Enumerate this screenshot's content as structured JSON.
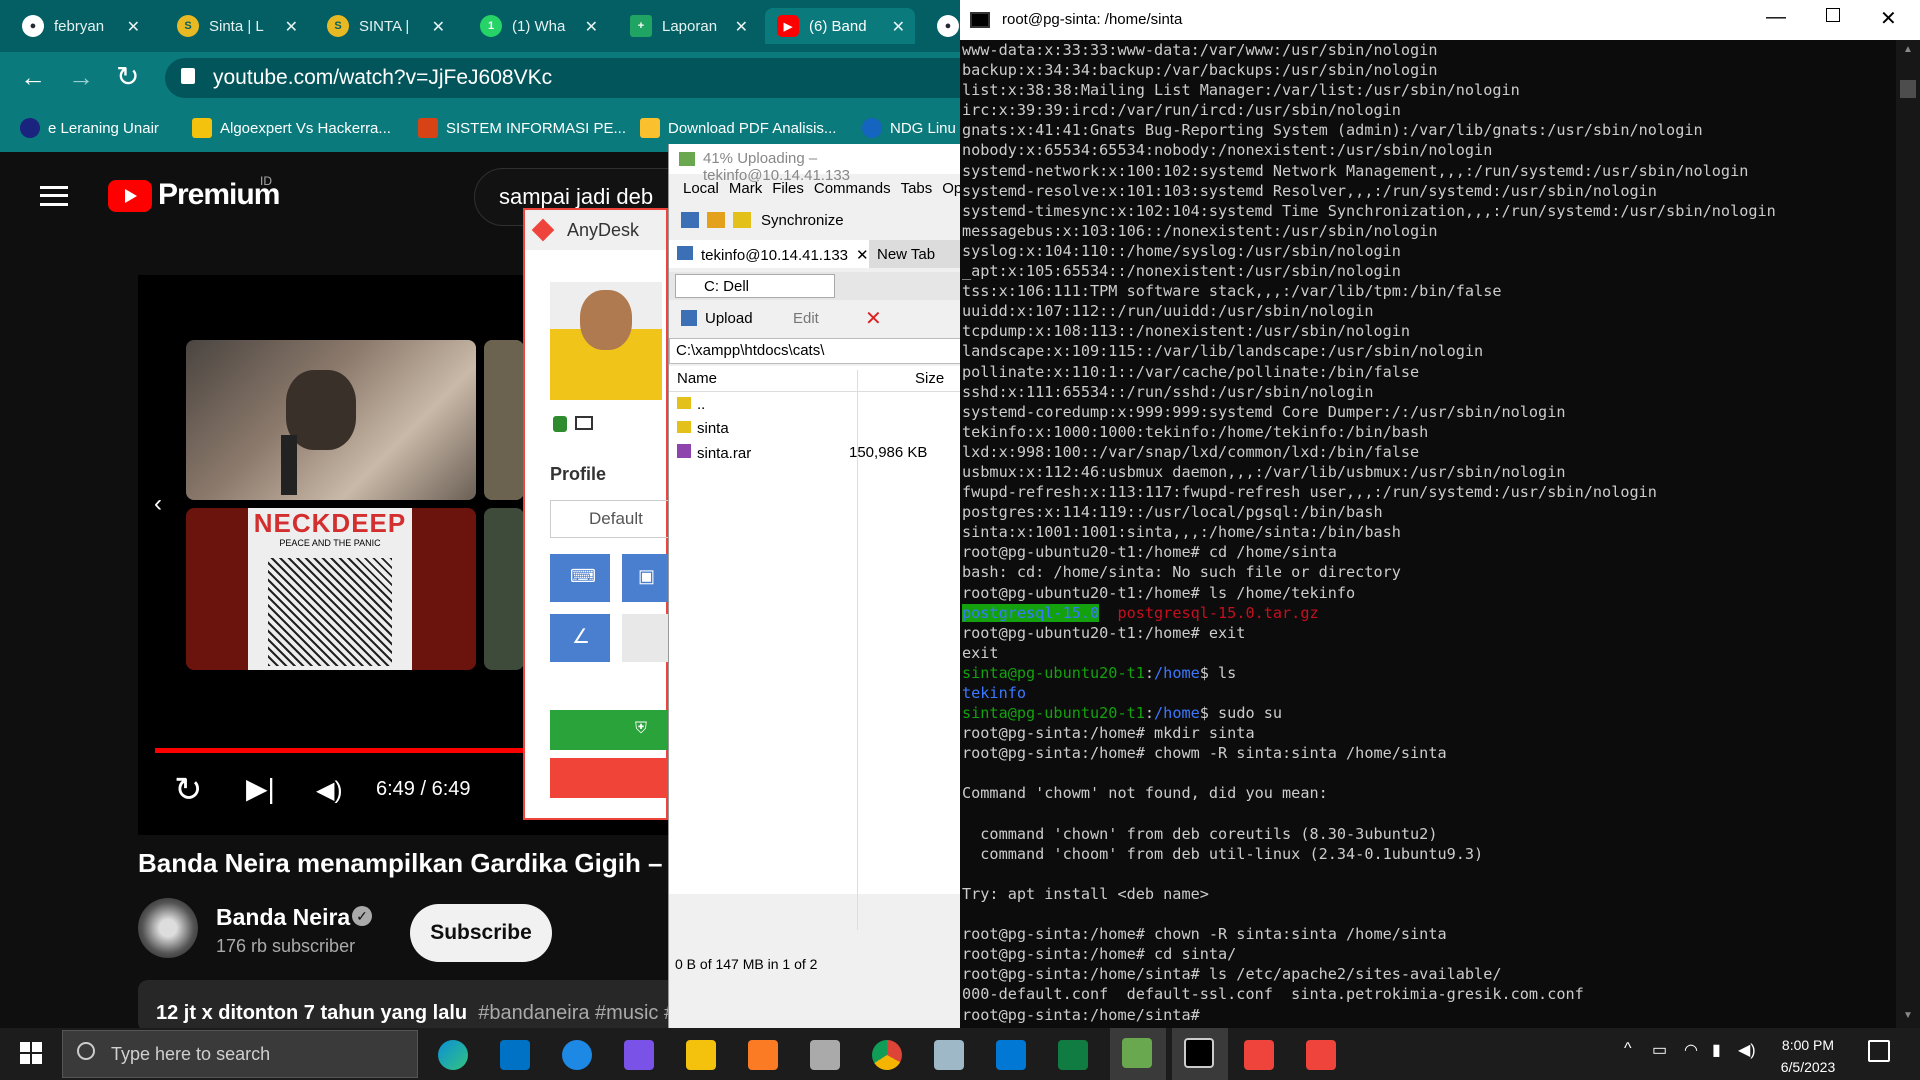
{
  "browser": {
    "tabs": [
      {
        "label": "febryan",
        "color": "#24292f"
      },
      {
        "label": "Sinta | L",
        "color": "#e8b923"
      },
      {
        "label": "SINTA |",
        "color": "#e8b923"
      },
      {
        "label": "(1) Wha",
        "color": "#25d366"
      },
      {
        "label": "Laporan",
        "color": "#1fa463"
      },
      {
        "label": "(6) Band",
        "color": "#ff0000"
      }
    ],
    "url": "youtube.com/watch?v=JjFeJ608VKc",
    "bookmarks": [
      {
        "label": "e Leraning Unair",
        "color": "#1a237e"
      },
      {
        "label": "Algoexpert Vs Hackerra...",
        "color": "#f4c20d"
      },
      {
        "label": "SISTEM INFORMASI PE...",
        "color": "#d84315"
      },
      {
        "label": "Download PDF Analisis...",
        "color": "#fbc02d"
      },
      {
        "label": "NDG Linu",
        "color": "#1565c0"
      }
    ]
  },
  "youtube": {
    "logo": "Premium",
    "region": "ID",
    "search_value": "sampai jadi deb",
    "time": "6:49 / 6:49",
    "progress": 1.0,
    "title": "Banda Neira menampilkan Gardika Gigih –",
    "channel": "Banda Neira",
    "subscribers": "176 rb subscriber",
    "subscribe_label": "Subscribe",
    "stats": "12 jt x ditonton  7 tahun yang lalu",
    "hashtags": "#bandaneira #music #indie",
    "album_text": "NECKDEEP",
    "album_sub": "PEACE AND THE PANIC"
  },
  "anydesk": {
    "title": "AnyDesk",
    "profile_label": "Profile",
    "profile_value": "Default"
  },
  "winscp": {
    "title": "41% Uploading – tekinfo@10.14.41.133",
    "menu": [
      "Local",
      "Mark",
      "Files",
      "Commands",
      "Tabs",
      "Op"
    ],
    "sync_label": "Synchronize",
    "session_tab": "tekinfo@10.14.41.133",
    "new_tab": "New Tab",
    "drive": "C: Dell",
    "upload": "Upload",
    "edit": "Edit",
    "path": "C:\\xampp\\htdocs\\cats\\",
    "col_name": "Name",
    "col_size": "Size",
    "files": [
      {
        "name": "..",
        "size": ""
      },
      {
        "name": "sinta",
        "size": ""
      },
      {
        "name": "sinta.rar",
        "size": "150,986 KB"
      }
    ],
    "status": "0 B of 147 MB in 1 of 2"
  },
  "terminal": {
    "title": "root@pg-sinta: /home/sinta",
    "lines": [
      "www-data:x:33:33:www-data:/var/www:/usr/sbin/nologin",
      "backup:x:34:34:backup:/var/backups:/usr/sbin/nologin",
      "list:x:38:38:Mailing List Manager:/var/list:/usr/sbin/nologin",
      "irc:x:39:39:ircd:/var/run/ircd:/usr/sbin/nologin",
      "gnats:x:41:41:Gnats Bug-Reporting System (admin):/var/lib/gnats:/usr/sbin/nologin",
      "nobody:x:65534:65534:nobody:/nonexistent:/usr/sbin/nologin",
      "systemd-network:x:100:102:systemd Network Management,,,:/run/systemd:/usr/sbin/nologin",
      "systemd-resolve:x:101:103:systemd Resolver,,,:/run/systemd:/usr/sbin/nologin",
      "systemd-timesync:x:102:104:systemd Time Synchronization,,,:/run/systemd:/usr/sbin/nologin",
      "messagebus:x:103:106::/nonexistent:/usr/sbin/nologin",
      "syslog:x:104:110::/home/syslog:/usr/sbin/nologin",
      "_apt:x:105:65534::/nonexistent:/usr/sbin/nologin",
      "tss:x:106:111:TPM software stack,,,:/var/lib/tpm:/bin/false",
      "uuidd:x:107:112::/run/uuidd:/usr/sbin/nologin",
      "tcpdump:x:108:113::/nonexistent:/usr/sbin/nologin",
      "landscape:x:109:115::/var/lib/landscape:/usr/sbin/nologin",
      "pollinate:x:110:1::/var/cache/pollinate:/bin/false",
      "sshd:x:111:65534::/run/sshd:/usr/sbin/nologin",
      "systemd-coredump:x:999:999:systemd Core Dumper:/:/usr/sbin/nologin",
      "tekinfo:x:1000:1000:tekinfo:/home/tekinfo:/bin/bash",
      "lxd:x:998:100::/var/snap/lxd/common/lxd:/bin/false",
      "usbmux:x:112:46:usbmux daemon,,,:/var/lib/usbmux:/usr/sbin/nologin",
      "fwupd-refresh:x:113:117:fwupd-refresh user,,,:/run/systemd:/usr/sbin/nologin",
      "postgres:x:114:119::/usr/local/pgsql:/bin/bash",
      "sinta:x:1001:1001:sinta,,,:/home/sinta:/bin/bash",
      "root@pg-ubuntu20-t1:/home# cd /home/sinta",
      "bash: cd: /home/sinta: No such file or directory",
      "root@pg-ubuntu20-t1:/home# ls /home/tekinfo"
    ],
    "ls_dir": "postgresql-15.0",
    "ls_file": "postgresql-15.0.tar.gz",
    "lines2": [
      "root@pg-ubuntu20-t1:/home# exit",
      "exit"
    ],
    "prompt_user": "sinta@pg-ubuntu20-t1",
    "prompt_path": "/home",
    "cmd_ls": "$ ls",
    "ls_out": "tekinfo",
    "cmd_su": "$ sudo su",
    "lines3": [
      "root@pg-sinta:/home# mkdir sinta",
      "root@pg-sinta:/home# chowm -R sinta:sinta /home/sinta",
      "",
      "Command 'chowm' not found, did you mean:",
      "",
      "  command 'chown' from deb coreutils (8.30-3ubuntu2)",
      "  command 'choom' from deb util-linux (2.34-0.1ubuntu9.3)",
      "",
      "Try: apt install <deb name>",
      "",
      "root@pg-sinta:/home# chown -R sinta:sinta /home/sinta",
      "root@pg-sinta:/home# cd sinta/",
      "root@pg-sinta:/home/sinta# ls /etc/apache2/sites-available/",
      "000-default.conf  default-ssl.conf  sinta.petrokimia-gresik.com.conf",
      "root@pg-sinta:/home/sinta#"
    ]
  },
  "taskbar": {
    "search_placeholder": "Type here to search",
    "time": "8:00 PM",
    "date": "6/5/2023"
  }
}
